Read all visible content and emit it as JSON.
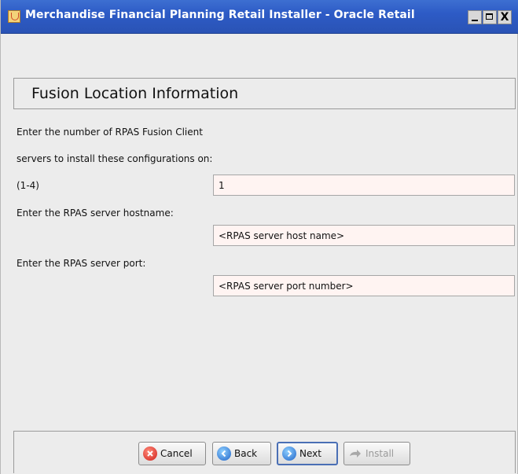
{
  "window": {
    "title": "Merchandise Financial Planning Retail Installer - Oracle Retail",
    "close_glyph": "X"
  },
  "header": {
    "title": "Fusion Location Information"
  },
  "form": {
    "servers_label_line1": "Enter the number of RPAS Fusion Client",
    "servers_label_line2": "servers to install these configurations on:",
    "servers_label_line3": "(1-4)",
    "servers_value": "1",
    "hostname_label": "Enter the RPAS server hostname:",
    "hostname_value": "<RPAS server host name>",
    "port_label": "Enter the RPAS server port:",
    "port_value": "<RPAS server port number>"
  },
  "buttons": {
    "cancel": "Cancel",
    "back": "Back",
    "next": "Next",
    "install": "Install"
  },
  "icons": {
    "app": "java-cup-icon",
    "cancel": "cancel-x-icon",
    "back": "arrow-left-icon",
    "next": "arrow-right-icon",
    "install": "install-arrow-icon"
  },
  "colors": {
    "titlebar": "#2d5bc6",
    "field_background": "#fff4f2",
    "next_focus_border": "#4a6fb5"
  }
}
